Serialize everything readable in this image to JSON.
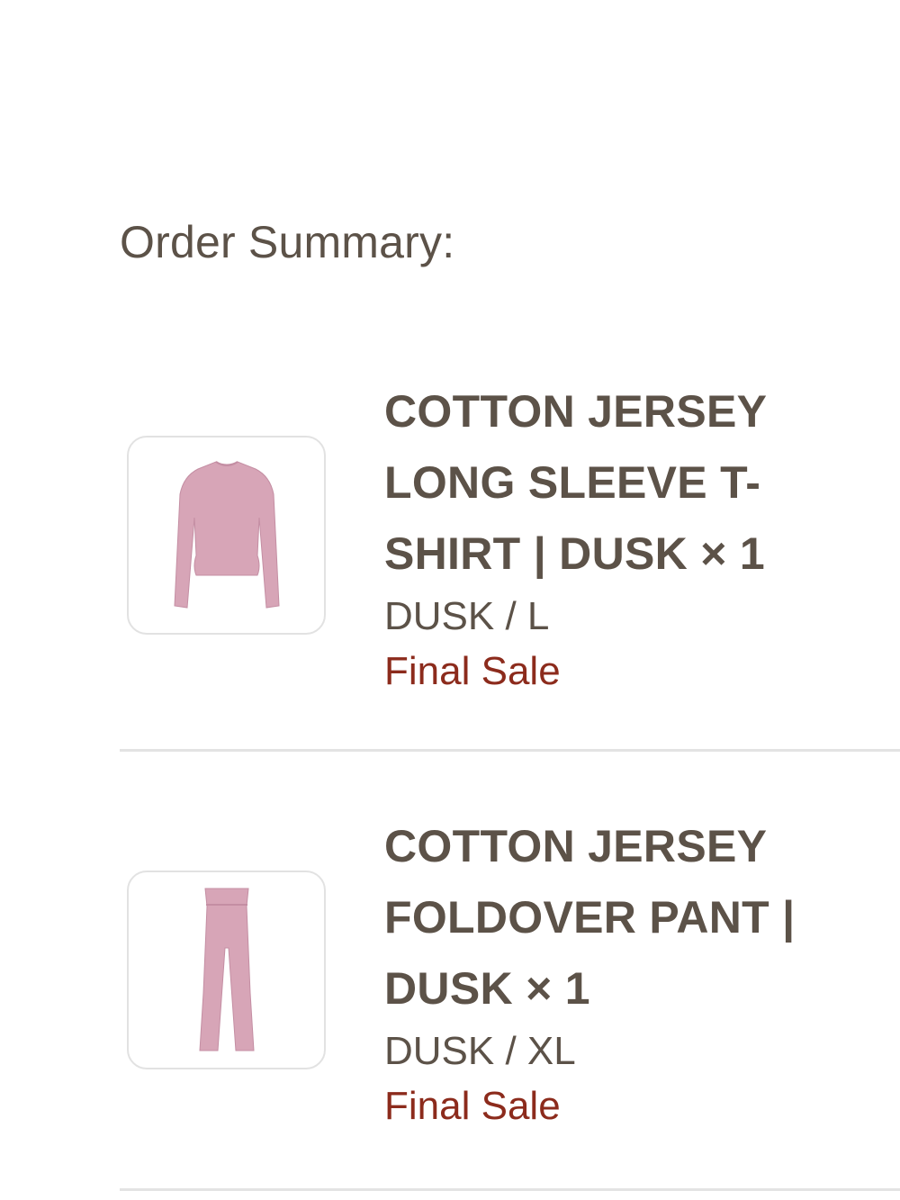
{
  "order_summary": {
    "title": "Order Summary:",
    "items": [
      {
        "name_lines": [
          "COTTON JERSEY",
          "LONG SLEEVE T-",
          "SHIRT | DUSK × 1"
        ],
        "variant": "DUSK / L",
        "sale_note": "Final Sale",
        "image_icon": "long-sleeve-shirt-icon",
        "product_color": "#d7a5b7"
      },
      {
        "name_lines": [
          "COTTON JERSEY",
          "FOLDOVER PANT |",
          "DUSK × 1"
        ],
        "variant": "DUSK / XL",
        "sale_note": "Final Sale",
        "image_icon": "foldover-pant-icon",
        "product_color": "#d7a5b7"
      }
    ]
  },
  "colors": {
    "text": "#5c5248",
    "final_sale": "#8c2b1c",
    "divider": "#e3e3e3",
    "thumb_border": "#e2e2e2"
  }
}
